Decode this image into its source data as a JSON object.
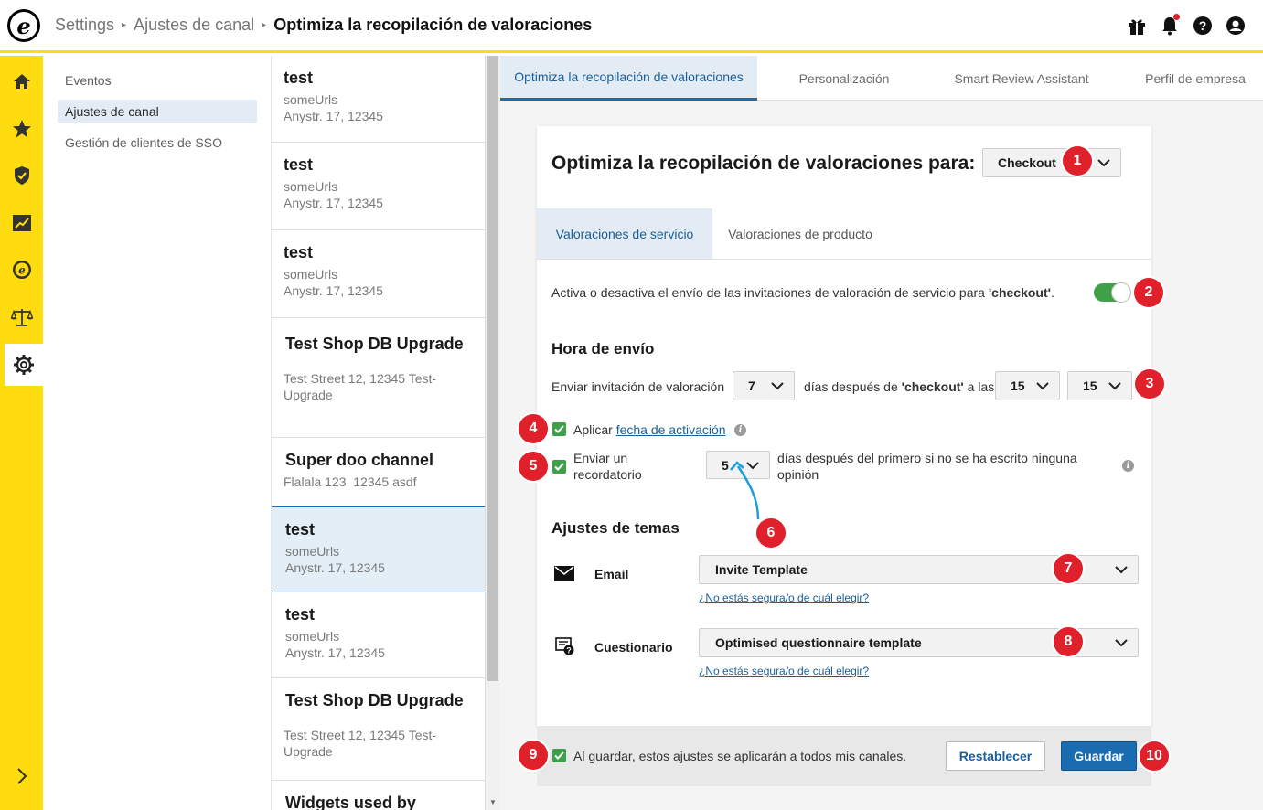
{
  "breadcrumb": {
    "root": "Settings",
    "parent": "Ajustes de canal",
    "current": "Optimiza la recopilación de valoraciones"
  },
  "settings_nav": {
    "items": [
      {
        "label": "Eventos"
      },
      {
        "label": "Ajustes de canal"
      },
      {
        "label": "Gestión de clientes de SSO"
      }
    ]
  },
  "channels": [
    {
      "name": "test",
      "line1": "someUrls",
      "line2": "Anystr. 17, 12345"
    },
    {
      "name": "test",
      "line1": "someUrls",
      "line2": "Anystr. 17, 12345"
    },
    {
      "name": "test",
      "line1": "someUrls",
      "line2": "Anystr. 17, 12345"
    },
    {
      "name": "Test Shop DB Upgrade",
      "line1": "Test Street 12, 12345 Test-",
      "line2": "Upgrade"
    },
    {
      "name": "Super doo channel",
      "line1": "Flalala 123, 12345 asdf",
      "line2": ""
    },
    {
      "name": "test",
      "line1": "someUrls",
      "line2": "Anystr. 17, 12345"
    },
    {
      "name": "test",
      "line1": "someUrls",
      "line2": "Anystr. 17, 12345"
    },
    {
      "name": "Test Shop DB Upgrade",
      "line1": "Test Street 12, 12345 Test-",
      "line2": "Upgrade"
    },
    {
      "name": "Widgets used by",
      "line1": "",
      "line2": ""
    }
  ],
  "tabs": [
    {
      "label": "Optimiza la recopilación de valoraciones"
    },
    {
      "label": "Personalización"
    },
    {
      "label": "Smart Review Assistant"
    },
    {
      "label": "Perfil de empresa"
    }
  ],
  "card": {
    "title": "Optimiza la recopilación de valoraciones para:",
    "event_select": "Checkout",
    "subtabs": [
      {
        "label": "Valoraciones de servicio"
      },
      {
        "label": "Valoraciones de producto"
      }
    ],
    "toggle_text": "Activa o desactiva el envío de las invitaciones de valoración de servicio para ",
    "toggle_text_bold": "'checkout'",
    "toggle_text_end": ".",
    "toggle_on": true,
    "send_time": {
      "title": "Hora de envío",
      "label": "Enviar invitación de valoración",
      "days": "7",
      "after_text": "días después de ",
      "after_bold": "'checkout'",
      "at_text": " a las",
      "hour": "15",
      "minute": "15"
    },
    "activation": {
      "prefix": "Aplicar ",
      "link": "fecha de activación",
      "checked": true
    },
    "reminder": {
      "label_1": "Enviar un",
      "label_2": "recordatorio",
      "days": "5",
      "text_1": "días después del primero si no se ha escrito ninguna",
      "text_2": "opinión",
      "checked": true
    },
    "themes": {
      "title": "Ajustes de temas",
      "email_label": "Email",
      "email_template": "Invite Template",
      "email_help": "¿No estás segura/o de cuál elegir?",
      "questionnaire_label": "Cuestionario",
      "questionnaire_template": "Optimised questionnaire template",
      "questionnaire_help": "¿No estás segura/o de cuál elegir?"
    },
    "footer": {
      "apply_all": "Al guardar, estos ajustes se aplicarán a todos mis canales.",
      "apply_checked": true,
      "reset": "Restablecer",
      "save": "Guardar"
    }
  },
  "badges": [
    "1",
    "2",
    "3",
    "4",
    "5",
    "6",
    "7",
    "8",
    "9",
    "10"
  ],
  "colors": {
    "brand_yellow": "#ffdc0f",
    "primary_blue": "#1a6cb0",
    "badge_red": "#e0202a",
    "check_green": "#3fa04a",
    "arrow_teal": "#1aa0d8"
  },
  "icons": {
    "rail": [
      "home-icon",
      "star-icon",
      "shield-check-icon",
      "chart-icon",
      "trusted-logo-icon",
      "scales-icon",
      "gear-icon",
      "chevron-right-icon"
    ],
    "top": [
      "gift-icon",
      "bell-icon",
      "help-icon",
      "user-icon"
    ]
  }
}
